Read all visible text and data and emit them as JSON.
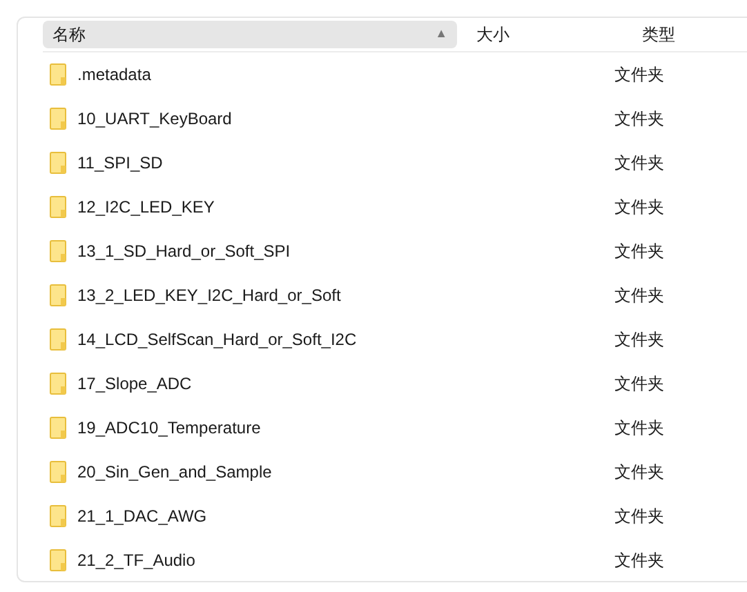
{
  "columns": [
    {
      "label": "名称",
      "sorted": true,
      "sort_arrow": "▲"
    },
    {
      "label": "大小",
      "sorted": false
    },
    {
      "label": "类型",
      "sorted": false
    }
  ],
  "rows": [
    {
      "name": ".metadata",
      "type": "文件夹"
    },
    {
      "name": "10_UART_KeyBoard",
      "type": "文件夹"
    },
    {
      "name": "11_SPI_SD",
      "type": "文件夹"
    },
    {
      "name": "12_I2C_LED_KEY",
      "type": "文件夹"
    },
    {
      "name": "13_1_SD_Hard_or_Soft_SPI",
      "type": "文件夹"
    },
    {
      "name": "13_2_LED_KEY_I2C_Hard_or_Soft",
      "type": "文件夹"
    },
    {
      "name": "14_LCD_SelfScan_Hard_or_Soft_I2C",
      "type": "文件夹"
    },
    {
      "name": "17_Slope_ADC",
      "type": "文件夹"
    },
    {
      "name": "19_ADC10_Temperature",
      "type": "文件夹"
    },
    {
      "name": "20_Sin_Gen_and_Sample",
      "type": "文件夹"
    },
    {
      "name": "21_1_DAC_AWG",
      "type": "文件夹"
    },
    {
      "name": "21_2_TF_Audio",
      "type": "文件夹"
    }
  ]
}
